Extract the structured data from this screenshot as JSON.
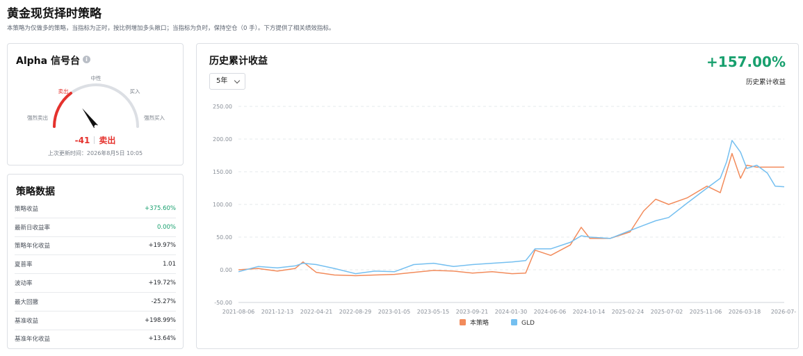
{
  "page": {
    "title": "黄金现货择时策略",
    "description": "本策略为仅做多的策略，当指标为正时，按比例增加多头敞口；当指标为负时，保持空仓（0 手）。下方提供了相关绩效指标。"
  },
  "signal_card": {
    "title": "Alpha 信号台",
    "info_icon": "info-icon",
    "gauge_labels": {
      "strong_sell": "强烈卖出",
      "sell": "卖出",
      "neutral": "中性",
      "buy": "买入",
      "strong_buy": "强烈买入"
    },
    "gauge_scale": [
      -100,
      100
    ],
    "gauge_value": -41,
    "signal_value": "-41",
    "signal_label": "卖出",
    "update_time": "上次更新时间：2026年8月5日 10:05",
    "colors": {
      "sell": "#e5322d",
      "track": "#dcdfe4"
    }
  },
  "metrics_card": {
    "title": "策略数据",
    "rows": [
      {
        "label": "策略收益",
        "value": "+375.60%",
        "positive": true
      },
      {
        "label": "最新日收益率",
        "value": "0.00%",
        "positive": true
      },
      {
        "label": "策略年化收益",
        "value": "+19.97%",
        "positive": false
      },
      {
        "label": "夏普率",
        "value": "1.01",
        "positive": false
      },
      {
        "label": "波动率",
        "value": "+19.72%",
        "positive": false
      },
      {
        "label": "最大回撤",
        "value": "-25.27%",
        "positive": false
      },
      {
        "label": "基准收益",
        "value": "+198.99%",
        "positive": false
      },
      {
        "label": "基准年化收益",
        "value": "+13.64%",
        "positive": false
      }
    ]
  },
  "chart_card": {
    "title": "历史累计收益",
    "range_selected": "5年",
    "total_return": "+157.00%",
    "total_return_label": "历史累计收益",
    "colors": {
      "strategy": "#f28b5b",
      "benchmark": "#74bff0",
      "positive": "#18a06e"
    }
  },
  "chart_data": {
    "type": "line",
    "title": "",
    "xlabel": "",
    "ylabel": "",
    "ylim": [
      -50,
      250
    ],
    "y_ticks": [
      "250.00",
      "200.00",
      "150.00",
      "100.00",
      "50.00",
      "0.00",
      "-50.00"
    ],
    "y_tick_values": [
      250,
      200,
      150,
      100,
      50,
      0,
      -50
    ],
    "x_tick_labels": [
      "2021-08-06",
      "2021-12-13",
      "2022-04-21",
      "2022-08-29",
      "2023-01-05",
      "2023-05-15",
      "2023-09-21",
      "2024-01-30",
      "2024-06-06",
      "2024-10-14",
      "2025-02-24",
      "2025-07-02",
      "2025-11-06",
      "2026-03-18",
      "2026-07-"
    ],
    "x": [
      "2021-08-06",
      "2021-10-10",
      "2021-12-13",
      "2022-02-10",
      "2022-03-08",
      "2022-04-21",
      "2022-06-20",
      "2022-08-29",
      "2022-11-01",
      "2023-01-05",
      "2023-03-10",
      "2023-05-15",
      "2023-07-20",
      "2023-09-21",
      "2023-11-25",
      "2024-01-30",
      "2024-03-15",
      "2024-04-15",
      "2024-06-06",
      "2024-08-10",
      "2024-09-15",
      "2024-10-14",
      "2024-12-20",
      "2025-02-24",
      "2025-04-10",
      "2025-05-20",
      "2025-07-02",
      "2025-09-01",
      "2025-11-06",
      "2025-12-20",
      "2026-01-10",
      "2026-01-28",
      "2026-02-25",
      "2026-03-18",
      "2026-04-20",
      "2026-05-25",
      "2026-06-20",
      "2026-07-20"
    ],
    "grid": true,
    "legend_position": "bottom",
    "series": [
      {
        "name": "本策略",
        "values": [
          0,
          2,
          -2,
          2,
          12,
          -4,
          -8,
          -9,
          -8,
          -7,
          -4,
          -1,
          -2,
          -5,
          -3,
          -6,
          -5,
          30,
          22,
          38,
          65,
          48,
          48,
          58,
          90,
          108,
          100,
          110,
          128,
          118,
          150,
          178,
          140,
          160,
          157,
          157,
          157,
          157
        ]
      },
      {
        "name": "GLD",
        "values": [
          -3,
          5,
          3,
          6,
          10,
          8,
          2,
          -6,
          -2,
          -3,
          8,
          10,
          5,
          8,
          10,
          12,
          14,
          32,
          32,
          42,
          52,
          50,
          48,
          60,
          68,
          75,
          80,
          102,
          125,
          140,
          165,
          198,
          180,
          155,
          160,
          148,
          128,
          127
        ]
      }
    ]
  }
}
